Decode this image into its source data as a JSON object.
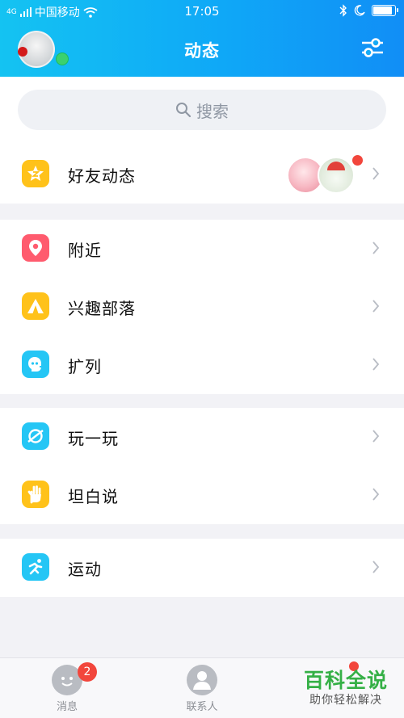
{
  "status_bar": {
    "network": "4G",
    "carrier": "中国移动",
    "time": "17:05",
    "battery_level": 0.9
  },
  "header": {
    "title": "动态"
  },
  "search": {
    "placeholder": "搜索"
  },
  "sections": [
    [
      {
        "label": "好友动态",
        "icon": "qzone-star-icon",
        "color": "#ffc21a"
      }
    ],
    [
      {
        "label": "附近",
        "icon": "location-pin-icon",
        "color": "#ff5b6e"
      },
      {
        "label": "兴趣部落",
        "icon": "tent-icon",
        "color": "#ffc21a"
      },
      {
        "label": "扩列",
        "icon": "add-friend-face-icon",
        "color": "#25c6f5"
      }
    ],
    [
      {
        "label": "玩一玩",
        "icon": "planet-icon",
        "color": "#25c6f5"
      },
      {
        "label": "坦白说",
        "icon": "raised-hand-icon",
        "color": "#ffc21a"
      }
    ],
    [
      {
        "label": "运动",
        "icon": "running-icon",
        "color": "#25c6f5"
      }
    ]
  ],
  "tabbar": {
    "messages": {
      "label": "消息",
      "badge": "2"
    },
    "contacts": {
      "label": "联系人"
    }
  },
  "watermark": {
    "main": "百科全说",
    "sub": "助你轻松解决"
  }
}
